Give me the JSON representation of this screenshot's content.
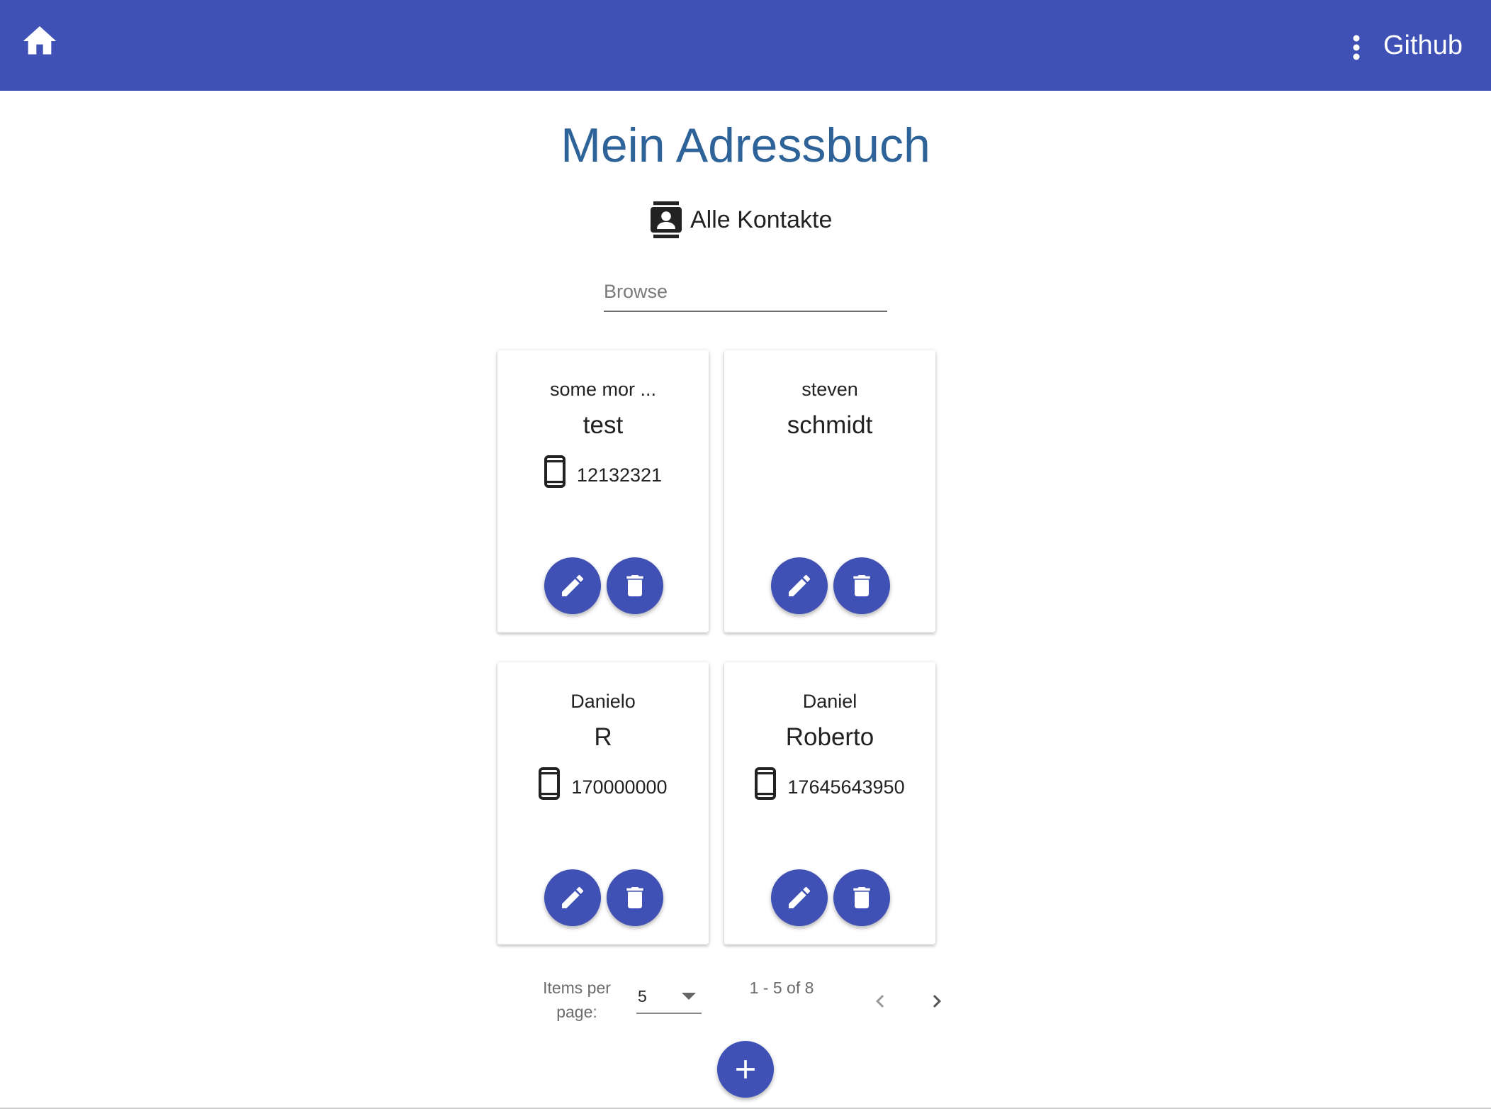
{
  "header": {
    "home_icon": "home-icon",
    "more_icon": "more-vert-icon",
    "github_label": "Github",
    "background": "#3f51b5"
  },
  "page": {
    "title": "Mein Adressbuch",
    "subtitle": "Alle Kontakte",
    "subtitle_icon": "contacts-icon"
  },
  "search": {
    "placeholder": "Browse",
    "value": ""
  },
  "contacts": [
    {
      "first_name": "some mor ...",
      "last_name": "test",
      "phone": "12132321"
    },
    {
      "first_name": "steven",
      "last_name": "schmidt",
      "phone": ""
    },
    {
      "first_name": "Danielo",
      "last_name": "R",
      "phone": "170000000"
    },
    {
      "first_name": "Daniel",
      "last_name": "Roberto",
      "phone": "17645643950"
    }
  ],
  "card_actions": {
    "edit_icon": "edit-icon",
    "delete_icon": "delete-icon",
    "phone_icon": "smartphone-icon"
  },
  "paginator": {
    "items_per_page_label": "Items per page:",
    "page_size": "5",
    "range_label": "1 - 5 of 8",
    "prev_icon": "chevron-left-icon",
    "next_icon": "chevron-right-icon"
  },
  "add_button": {
    "icon": "add-icon"
  },
  "colors": {
    "primary": "#3f51b5",
    "title": "#2e6399"
  }
}
